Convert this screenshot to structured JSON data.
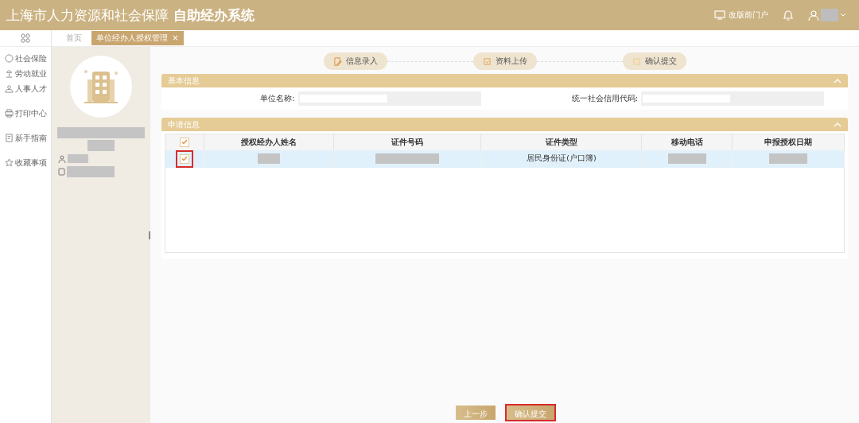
{
  "header": {
    "title": "上海市人力资源和社会保障",
    "subtitle": "自助经办系统",
    "portal_link": "改版前门户"
  },
  "tabs": [
    {
      "label": "首页",
      "selected": false
    },
    {
      "label": "单位经办人授权管理",
      "selected": true,
      "close": "×"
    }
  ],
  "nav": [
    {
      "label": "社会保险",
      "kind": "shield"
    },
    {
      "label": "劳动就业",
      "kind": "worker"
    },
    {
      "label": "人事人才",
      "kind": "people"
    },
    {
      "label": "打印中心",
      "kind": "printer"
    },
    {
      "label": "新手指南",
      "kind": "guide"
    },
    {
      "label": "收藏事项",
      "kind": "star"
    }
  ],
  "steps": [
    {
      "label": "信息录入",
      "kind": "edit"
    },
    {
      "label": "资料上传",
      "kind": "upload"
    },
    {
      "label": "确认提交",
      "kind": "confirm"
    }
  ],
  "basic_info": {
    "title": "基本信息",
    "expanded": true,
    "fields": [
      {
        "label": "单位名称:"
      },
      {
        "label": "统一社会信用代码:"
      }
    ]
  },
  "apply_info": {
    "title": "申请信息",
    "expanded": true,
    "columns": [
      "授权经办人姓名",
      "证件号码",
      "证件类型",
      "移动电话",
      "申报授权日期"
    ],
    "all_checked": true,
    "rows": [
      {
        "checked": true,
        "selected": true,
        "cells": [
          {
            "kind": "redacted"
          },
          {
            "kind": "redacted"
          },
          {
            "kind": "text",
            "text": "居民身份证(户口簿)"
          },
          {
            "kind": "redacted"
          },
          {
            "kind": "redacted"
          }
        ]
      }
    ]
  },
  "buttons": [
    {
      "label": "上一步",
      "highlighted": false
    },
    {
      "label": "确认提交",
      "highlighted": true
    }
  ]
}
